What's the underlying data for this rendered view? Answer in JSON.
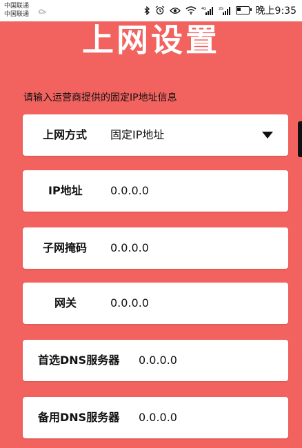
{
  "status_bar": {
    "carrier_1": "中国联通",
    "carrier_2": "中国联通",
    "time": "晚上9:35"
  },
  "page": {
    "title": "上网设置",
    "hint": "请输入运营商提供的固定IP地址信息"
  },
  "form": {
    "connection_type": {
      "label": "上网方式",
      "value": "固定IP地址"
    },
    "ip_address": {
      "label": "IP地址",
      "value": "0.0.0.0"
    },
    "subnet_mask": {
      "label": "子网掩码",
      "value": "0.0.0.0"
    },
    "gateway": {
      "label": "网关",
      "value": "0.0.0.0"
    },
    "primary_dns": {
      "label": "首选DNS服务器",
      "value": "0.0.0.0"
    },
    "secondary_dns": {
      "label": "备用DNS服务器",
      "value": "0.0.0.0"
    }
  },
  "colors": {
    "background": "#f2625e",
    "card": "#ffffff",
    "title": "#ffffff"
  }
}
